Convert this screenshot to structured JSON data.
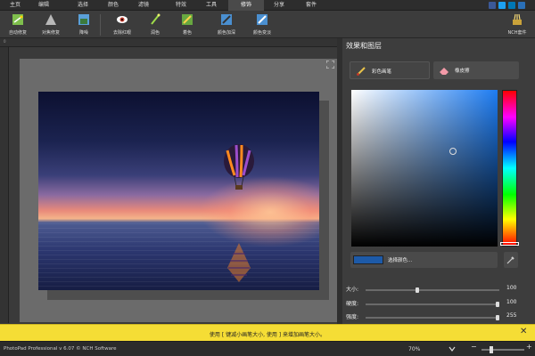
{
  "menu": [
    "主页",
    "编辑",
    "选择",
    "颜色",
    "滤镜",
    "特效",
    "工具",
    "修饰",
    "分享",
    "套件"
  ],
  "toolbar": {
    "tools": [
      "自动修复",
      "对焦修复",
      "降噪",
      "去除红眼",
      "润色",
      "着色",
      "颜色加深",
      "颜色变淡"
    ],
    "suite_label": "NCH套件"
  },
  "panel": {
    "title": "效果和图层",
    "brush_tabs": [
      "彩色画笔",
      "橡皮擦"
    ],
    "select_color_label": "选择颜色...",
    "current_color": "#1d5aa8",
    "sliders": [
      {
        "label": "大小:",
        "value": "100",
        "level": 0.39
      },
      {
        "label": "硬度:",
        "value": "100",
        "level": 1.0
      },
      {
        "label": "强度:",
        "value": "255",
        "level": 1.0
      }
    ]
  },
  "hint": "使用 [ 键减小画笔大小, 使用 ] 来增加画笔大小。",
  "status": {
    "app": "PhotoPad Professional v 6.07 © NCH Software",
    "zoom": "70%"
  },
  "colors": {
    "menu_bg": "#2d2d2d",
    "panel_bg": "#3d3d3d",
    "hint_bg": "#f5dd35",
    "accent": "#1d7cf2"
  }
}
